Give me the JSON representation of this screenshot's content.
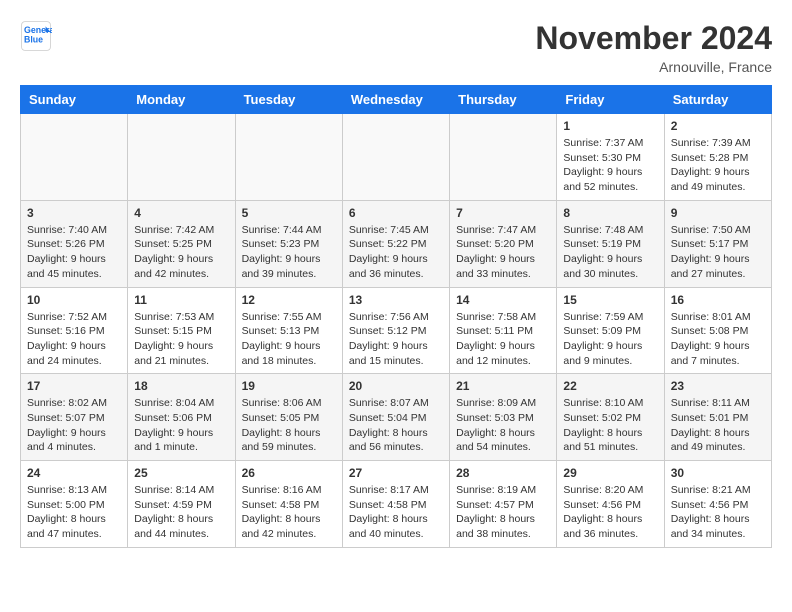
{
  "header": {
    "logo_line1": "General",
    "logo_line2": "Blue",
    "month": "November 2024",
    "location": "Arnouville, France"
  },
  "weekdays": [
    "Sunday",
    "Monday",
    "Tuesday",
    "Wednesday",
    "Thursday",
    "Friday",
    "Saturday"
  ],
  "weeks": [
    [
      {
        "day": "",
        "info": ""
      },
      {
        "day": "",
        "info": ""
      },
      {
        "day": "",
        "info": ""
      },
      {
        "day": "",
        "info": ""
      },
      {
        "day": "",
        "info": ""
      },
      {
        "day": "1",
        "info": "Sunrise: 7:37 AM\nSunset: 5:30 PM\nDaylight: 9 hours and 52 minutes."
      },
      {
        "day": "2",
        "info": "Sunrise: 7:39 AM\nSunset: 5:28 PM\nDaylight: 9 hours and 49 minutes."
      }
    ],
    [
      {
        "day": "3",
        "info": "Sunrise: 7:40 AM\nSunset: 5:26 PM\nDaylight: 9 hours and 45 minutes."
      },
      {
        "day": "4",
        "info": "Sunrise: 7:42 AM\nSunset: 5:25 PM\nDaylight: 9 hours and 42 minutes."
      },
      {
        "day": "5",
        "info": "Sunrise: 7:44 AM\nSunset: 5:23 PM\nDaylight: 9 hours and 39 minutes."
      },
      {
        "day": "6",
        "info": "Sunrise: 7:45 AM\nSunset: 5:22 PM\nDaylight: 9 hours and 36 minutes."
      },
      {
        "day": "7",
        "info": "Sunrise: 7:47 AM\nSunset: 5:20 PM\nDaylight: 9 hours and 33 minutes."
      },
      {
        "day": "8",
        "info": "Sunrise: 7:48 AM\nSunset: 5:19 PM\nDaylight: 9 hours and 30 minutes."
      },
      {
        "day": "9",
        "info": "Sunrise: 7:50 AM\nSunset: 5:17 PM\nDaylight: 9 hours and 27 minutes."
      }
    ],
    [
      {
        "day": "10",
        "info": "Sunrise: 7:52 AM\nSunset: 5:16 PM\nDaylight: 9 hours and 24 minutes."
      },
      {
        "day": "11",
        "info": "Sunrise: 7:53 AM\nSunset: 5:15 PM\nDaylight: 9 hours and 21 minutes."
      },
      {
        "day": "12",
        "info": "Sunrise: 7:55 AM\nSunset: 5:13 PM\nDaylight: 9 hours and 18 minutes."
      },
      {
        "day": "13",
        "info": "Sunrise: 7:56 AM\nSunset: 5:12 PM\nDaylight: 9 hours and 15 minutes."
      },
      {
        "day": "14",
        "info": "Sunrise: 7:58 AM\nSunset: 5:11 PM\nDaylight: 9 hours and 12 minutes."
      },
      {
        "day": "15",
        "info": "Sunrise: 7:59 AM\nSunset: 5:09 PM\nDaylight: 9 hours and 9 minutes."
      },
      {
        "day": "16",
        "info": "Sunrise: 8:01 AM\nSunset: 5:08 PM\nDaylight: 9 hours and 7 minutes."
      }
    ],
    [
      {
        "day": "17",
        "info": "Sunrise: 8:02 AM\nSunset: 5:07 PM\nDaylight: 9 hours and 4 minutes."
      },
      {
        "day": "18",
        "info": "Sunrise: 8:04 AM\nSunset: 5:06 PM\nDaylight: 9 hours and 1 minute."
      },
      {
        "day": "19",
        "info": "Sunrise: 8:06 AM\nSunset: 5:05 PM\nDaylight: 8 hours and 59 minutes."
      },
      {
        "day": "20",
        "info": "Sunrise: 8:07 AM\nSunset: 5:04 PM\nDaylight: 8 hours and 56 minutes."
      },
      {
        "day": "21",
        "info": "Sunrise: 8:09 AM\nSunset: 5:03 PM\nDaylight: 8 hours and 54 minutes."
      },
      {
        "day": "22",
        "info": "Sunrise: 8:10 AM\nSunset: 5:02 PM\nDaylight: 8 hours and 51 minutes."
      },
      {
        "day": "23",
        "info": "Sunrise: 8:11 AM\nSunset: 5:01 PM\nDaylight: 8 hours and 49 minutes."
      }
    ],
    [
      {
        "day": "24",
        "info": "Sunrise: 8:13 AM\nSunset: 5:00 PM\nDaylight: 8 hours and 47 minutes."
      },
      {
        "day": "25",
        "info": "Sunrise: 8:14 AM\nSunset: 4:59 PM\nDaylight: 8 hours and 44 minutes."
      },
      {
        "day": "26",
        "info": "Sunrise: 8:16 AM\nSunset: 4:58 PM\nDaylight: 8 hours and 42 minutes."
      },
      {
        "day": "27",
        "info": "Sunrise: 8:17 AM\nSunset: 4:58 PM\nDaylight: 8 hours and 40 minutes."
      },
      {
        "day": "28",
        "info": "Sunrise: 8:19 AM\nSunset: 4:57 PM\nDaylight: 8 hours and 38 minutes."
      },
      {
        "day": "29",
        "info": "Sunrise: 8:20 AM\nSunset: 4:56 PM\nDaylight: 8 hours and 36 minutes."
      },
      {
        "day": "30",
        "info": "Sunrise: 8:21 AM\nSunset: 4:56 PM\nDaylight: 8 hours and 34 minutes."
      }
    ]
  ]
}
